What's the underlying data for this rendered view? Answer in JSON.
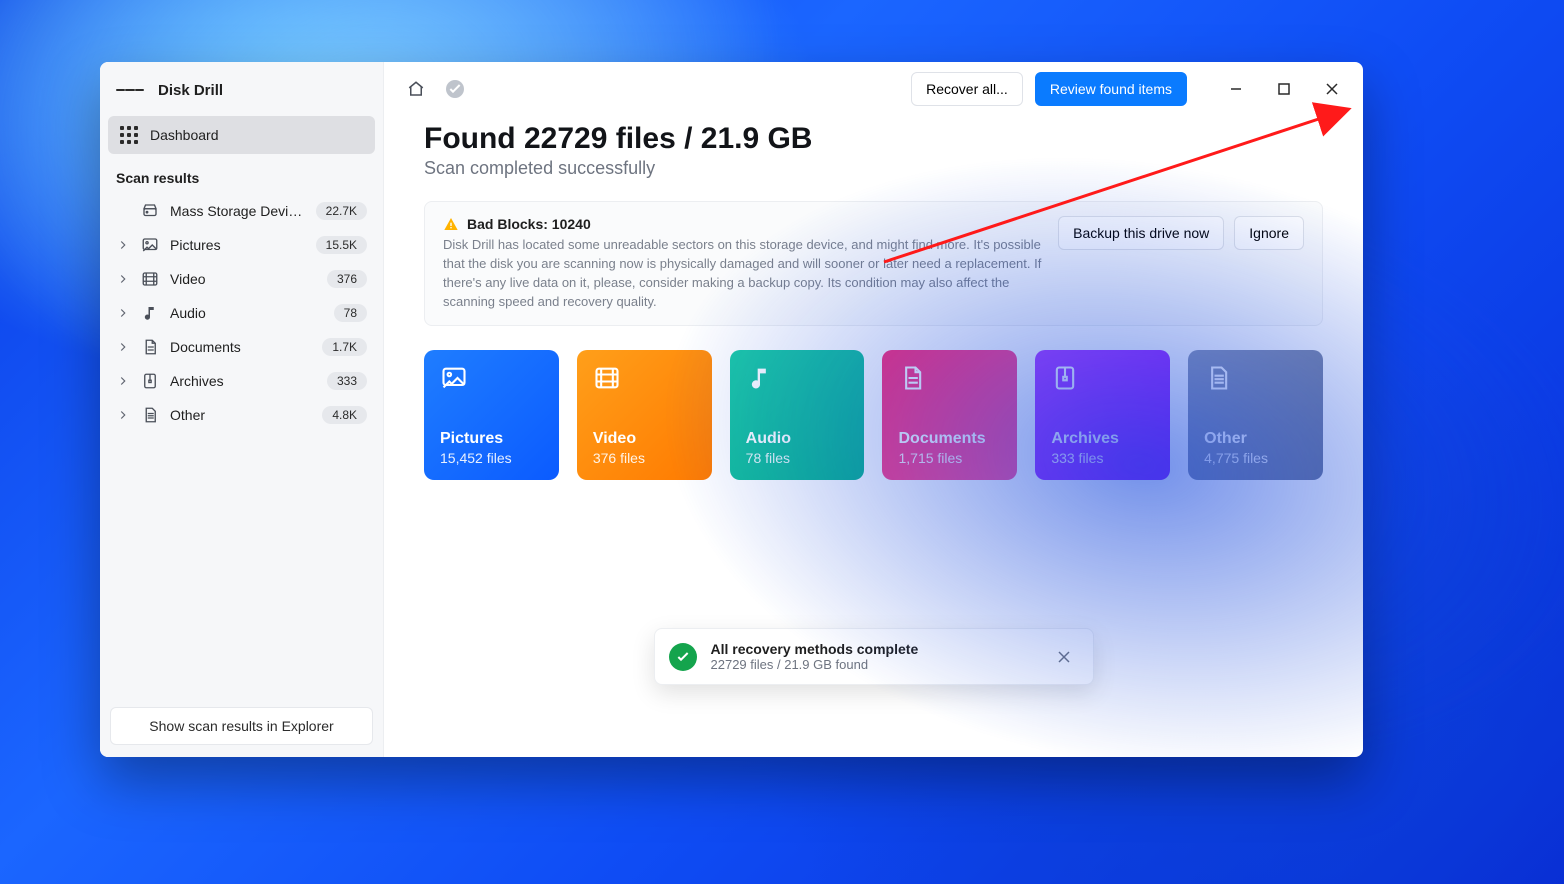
{
  "app": {
    "name": "Disk Drill"
  },
  "sidebar": {
    "dashboard_label": "Dashboard",
    "section_title": "Scan results",
    "items": {
      "0": {
        "label": "Mass Storage Device U...",
        "badge": "22.7K",
        "icon": "drive-icon",
        "expandable": false
      },
      "1": {
        "label": "Pictures",
        "badge": "15.5K",
        "icon": "image-icon",
        "expandable": true
      },
      "2": {
        "label": "Video",
        "badge": "376",
        "icon": "film-icon",
        "expandable": true
      },
      "3": {
        "label": "Audio",
        "badge": "78",
        "icon": "music-icon",
        "expandable": true
      },
      "4": {
        "label": "Documents",
        "badge": "1.7K",
        "icon": "document-icon",
        "expandable": true
      },
      "5": {
        "label": "Archives",
        "badge": "333",
        "icon": "archive-icon",
        "expandable": true
      },
      "6": {
        "label": "Other",
        "badge": "4.8K",
        "icon": "file-icon",
        "expandable": true
      }
    },
    "footer_button": "Show scan results in Explorer"
  },
  "toolbar": {
    "recover_all": "Recover all...",
    "review_found": "Review found items"
  },
  "summary": {
    "headline": "Found 22729 files / 21.9 GB",
    "subhead": "Scan completed successfully"
  },
  "alert": {
    "title": "Bad Blocks: 10240",
    "text": "Disk Drill has located some unreadable sectors on this storage device, and might find more. It's possible that the disk you are scanning now is physically damaged and will sooner or later need a replacement. If there's any live data on it, please, consider making a backup copy. Its condition may also affect the scanning speed and recovery quality.",
    "backup": "Backup this drive now",
    "ignore": "Ignore"
  },
  "cards": {
    "0": {
      "title": "Pictures",
      "subtitle": "15,452 files",
      "bg": "linear-gradient(135deg,#1f7dff,#0b5bff)",
      "icon": "image-icon"
    },
    "1": {
      "title": "Video",
      "subtitle": "376 files",
      "bg": "linear-gradient(135deg,#ff9f1a,#ff7a00)",
      "icon": "film-icon"
    },
    "2": {
      "title": "Audio",
      "subtitle": "78 files",
      "bg": "linear-gradient(135deg,#1cc9a7,#0bb391)",
      "icon": "music-icon"
    },
    "3": {
      "title": "Documents",
      "subtitle": "1,715 files",
      "bg": "linear-gradient(135deg,#fc2d7a,#ff4f9a)",
      "icon": "document-icon"
    },
    "4": {
      "title": "Archives",
      "subtitle": "333 files",
      "bg": "linear-gradient(135deg,#b03dff,#8a1cff)",
      "icon": "archive-icon"
    },
    "5": {
      "title": "Other",
      "subtitle": "4,775 files",
      "bg": "linear-gradient(135deg,#8e98b4,#6f7a9b)",
      "icon": "file-icon"
    }
  },
  "toast": {
    "title": "All recovery methods complete",
    "subtitle": "22729 files / 21.9 GB found"
  },
  "colors": {
    "primary": "#0a7bff"
  },
  "annotation": {
    "show_arrow": true
  }
}
